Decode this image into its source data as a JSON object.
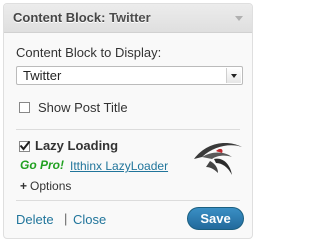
{
  "widget": {
    "title": "Content Block:",
    "title_instance": "Twitter"
  },
  "content_block": {
    "label": "Content Block to Display:",
    "selected": "Twitter"
  },
  "show_post_title": {
    "label": "Show Post Title",
    "checked": false
  },
  "lazy_loading": {
    "label": "Lazy Loading",
    "checked": true,
    "go_pro": "Go Pro!",
    "link": "Itthinx LazyLoader",
    "logo_icon": "itthinx-logo-icon"
  },
  "options": {
    "plus": "+",
    "label": "Options"
  },
  "actions": {
    "delete": "Delete",
    "separator": "|",
    "close": "Close",
    "save": "Save"
  },
  "colors": {
    "link": "#21759b",
    "go_pro": "#21a121",
    "save_button": "#2a78ad",
    "header_bg": "#dfdfdf"
  }
}
